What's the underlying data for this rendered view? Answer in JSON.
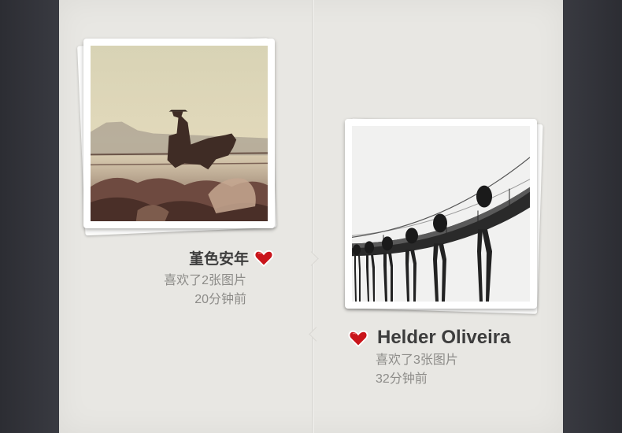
{
  "feed": {
    "items": [
      {
        "user_name": "堇色安年",
        "action": "喜欢了2张图片",
        "time": "20分钟前"
      },
      {
        "user_name": "Helder Oliveira",
        "action": "喜欢了3张图片",
        "time": "32分钟前"
      }
    ]
  },
  "colors": {
    "heart": "#c9151b",
    "panel": "#e8e7e3",
    "background": "#33343b"
  },
  "icons": {
    "like": "heart-icon"
  }
}
